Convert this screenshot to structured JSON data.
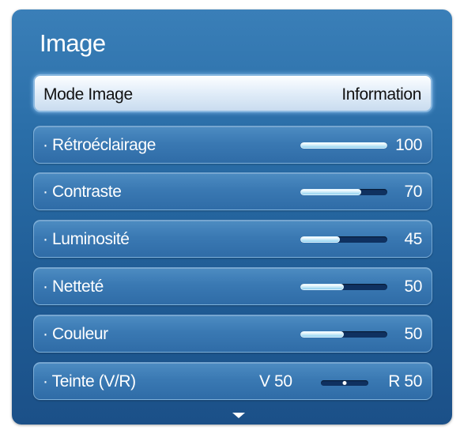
{
  "menu": {
    "title": "Image",
    "mode": {
      "label": "Mode Image",
      "value": "Information"
    },
    "settings": [
      {
        "id": "retroeclairage",
        "label": "· Rétroéclairage",
        "value": "100",
        "level": 100
      },
      {
        "id": "contraste",
        "label": "· Contraste",
        "value": "70",
        "level": 70
      },
      {
        "id": "luminosite",
        "label": "· Luminosité",
        "value": "45",
        "level": 45
      },
      {
        "id": "nettete",
        "label": "· Netteté",
        "value": "50",
        "level": 50
      },
      {
        "id": "couleur",
        "label": "· Couleur",
        "value": "50",
        "level": 50
      }
    ],
    "tint": {
      "label": "· Teinte (V/R)",
      "left_value": "V 50",
      "right_value": "R 50",
      "balance": 50
    },
    "more_icon": "chevron-down-icon"
  },
  "colors": {
    "panel_blue": "#2a6ea8",
    "selected_row": "#e6f0fa",
    "slider_track": "#0f3160",
    "slider_fill": "#bfe6f7"
  }
}
